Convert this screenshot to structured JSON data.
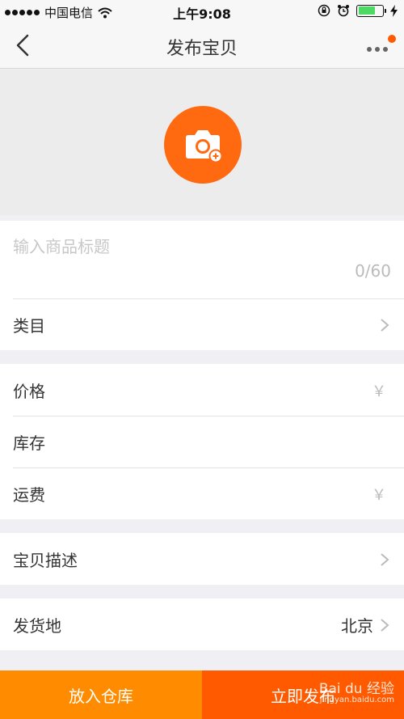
{
  "status_bar": {
    "carrier": "中国电信",
    "time": "上午9:08",
    "battery_level": 0.7
  },
  "nav": {
    "title": "发布宝贝",
    "back_icon": "chevron-left-icon",
    "more_icon": "more-icon"
  },
  "photo": {
    "icon": "camera-add-icon",
    "accent_color": "#ff6a10"
  },
  "form": {
    "title_placeholder": "输入商品标题",
    "title_value": "",
    "char_count": "0/60",
    "category_label": "类目",
    "price_label": "价格",
    "price_unit": "￥",
    "stock_label": "库存",
    "shipping_label": "运费",
    "shipping_unit": "￥",
    "description_label": "宝贝描述",
    "ship_from_label": "发货地",
    "ship_from_value": "北京"
  },
  "bottom": {
    "warehouse_label": "放入仓库",
    "publish_label": "立即发布",
    "warehouse_color": "#ff8c00",
    "publish_color": "#ff5a00"
  },
  "watermark": {
    "brand": "Bai du 经验",
    "url": "jingyan.baidu.com"
  }
}
